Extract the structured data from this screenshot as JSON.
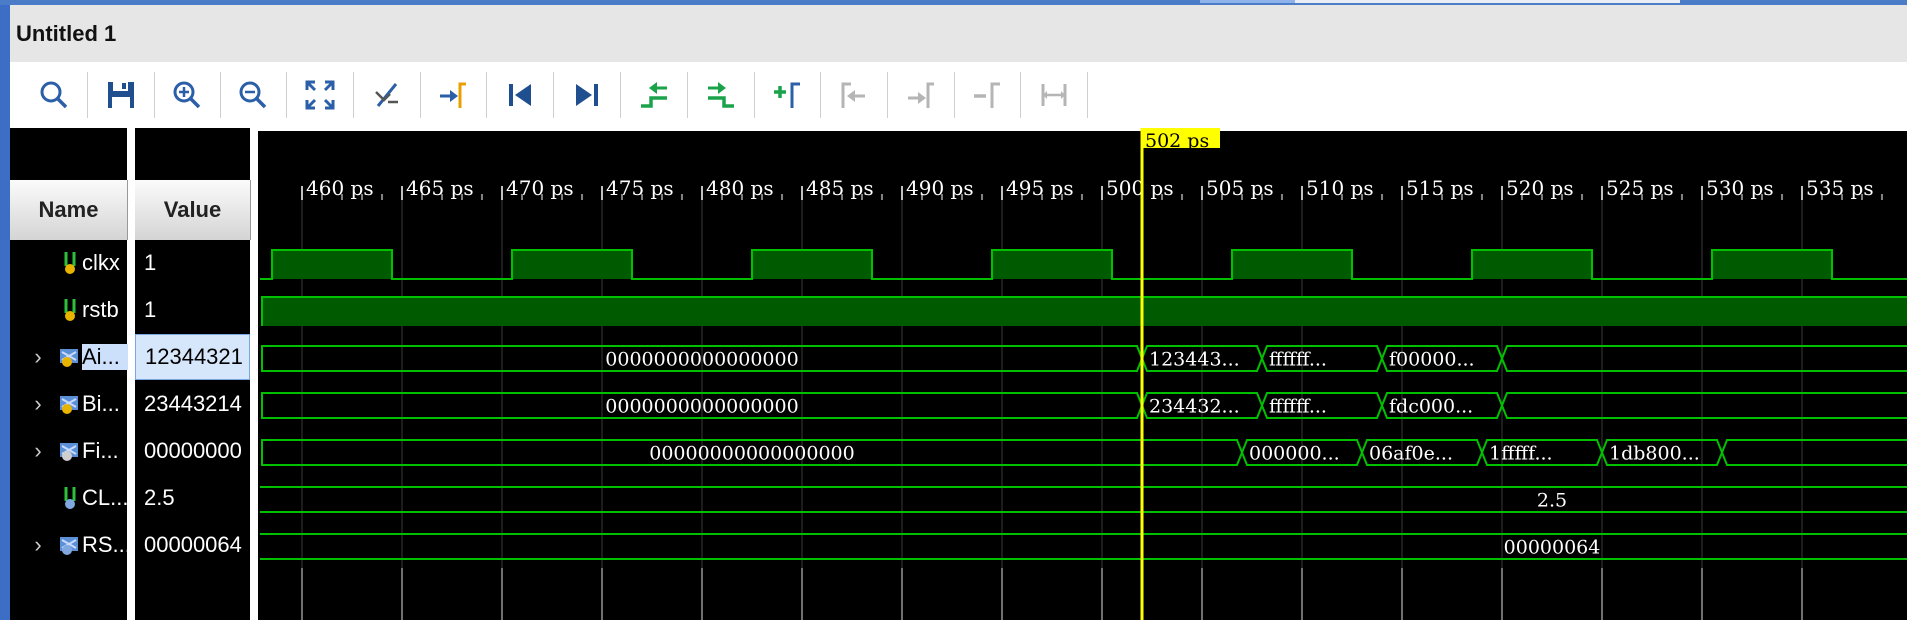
{
  "window": {
    "title": "Untitled 1"
  },
  "toolbar": {
    "buttons": [
      {
        "name": "search-button",
        "icon": "search-icon"
      },
      {
        "name": "save-button",
        "icon": "save-icon"
      },
      {
        "name": "zoom-in-button",
        "icon": "zoom-in-icon"
      },
      {
        "name": "zoom-out-button",
        "icon": "zoom-out-icon"
      },
      {
        "name": "zoom-fit-button",
        "icon": "zoom-fit-icon"
      },
      {
        "name": "cursor-snap-button",
        "icon": "cursor-snap-icon"
      },
      {
        "name": "go-to-cursor-button",
        "icon": "go-to-cursor-icon"
      },
      {
        "name": "go-to-time-zero-button",
        "icon": "go-to-start-icon"
      },
      {
        "name": "go-to-last-time-button",
        "icon": "go-to-end-icon"
      },
      {
        "name": "previous-transition-button",
        "icon": "previous-transition-icon"
      },
      {
        "name": "next-transition-button",
        "icon": "next-transition-icon"
      },
      {
        "name": "add-marker-button",
        "icon": "add-marker-icon"
      },
      {
        "name": "previous-marker-button",
        "icon": "previous-marker-icon"
      },
      {
        "name": "next-marker-button",
        "icon": "next-marker-icon"
      },
      {
        "name": "delete-marker-button",
        "icon": "delete-marker-icon"
      },
      {
        "name": "swap-cursors-button",
        "icon": "swap-cursors-icon"
      }
    ]
  },
  "columns": {
    "name": "Name",
    "value": "Value"
  },
  "signals": [
    {
      "name": "clkx",
      "value": "1",
      "expandable": false,
      "icon": "bit-signal-icon"
    },
    {
      "name": "rstb",
      "value": "1",
      "expandable": false,
      "icon": "bit-signal-icon"
    },
    {
      "name": "Ai...",
      "value": "12344321",
      "expandable": true,
      "icon": "bus-signal-icon",
      "selected": true
    },
    {
      "name": "Bi...",
      "value": "23443214",
      "expandable": true,
      "icon": "bus-signal-icon"
    },
    {
      "name": "Fi...",
      "value": "00000000",
      "expandable": true,
      "icon": "bus-signal-icon"
    },
    {
      "name": "CL...",
      "value": "2.5",
      "expandable": false,
      "icon": "constant-signal-icon"
    },
    {
      "name": "RS...",
      "value": "00000064",
      "expandable": true,
      "icon": "constant-bus-icon"
    }
  ],
  "timeline": {
    "cursor_label": "502 ps",
    "ticks": [
      "460 ps",
      "465 ps",
      "470 ps",
      "475 ps",
      "480 ps",
      "485 ps",
      "490 ps",
      "495 ps",
      "500 ps",
      "505 ps",
      "510 ps",
      "515 ps",
      "520 ps",
      "525 ps",
      "530 ps",
      "535 ps"
    ]
  },
  "bus_labels": {
    "ai": [
      "0000000000000000",
      "123443...",
      "ffffff...",
      "f00000..."
    ],
    "bi": [
      "0000000000000000",
      "234432...",
      "ffffff...",
      "fdc000..."
    ],
    "fi": [
      "00000000000000000",
      "000000...",
      "06af0e...",
      "1fffff...",
      "1db800..."
    ],
    "cl": [
      "2.5"
    ],
    "rs": [
      "00000064"
    ]
  },
  "colors": {
    "wave": "#00c000",
    "wave_fill": "#005a00",
    "cursor": "#ffff00",
    "background": "#000000"
  }
}
